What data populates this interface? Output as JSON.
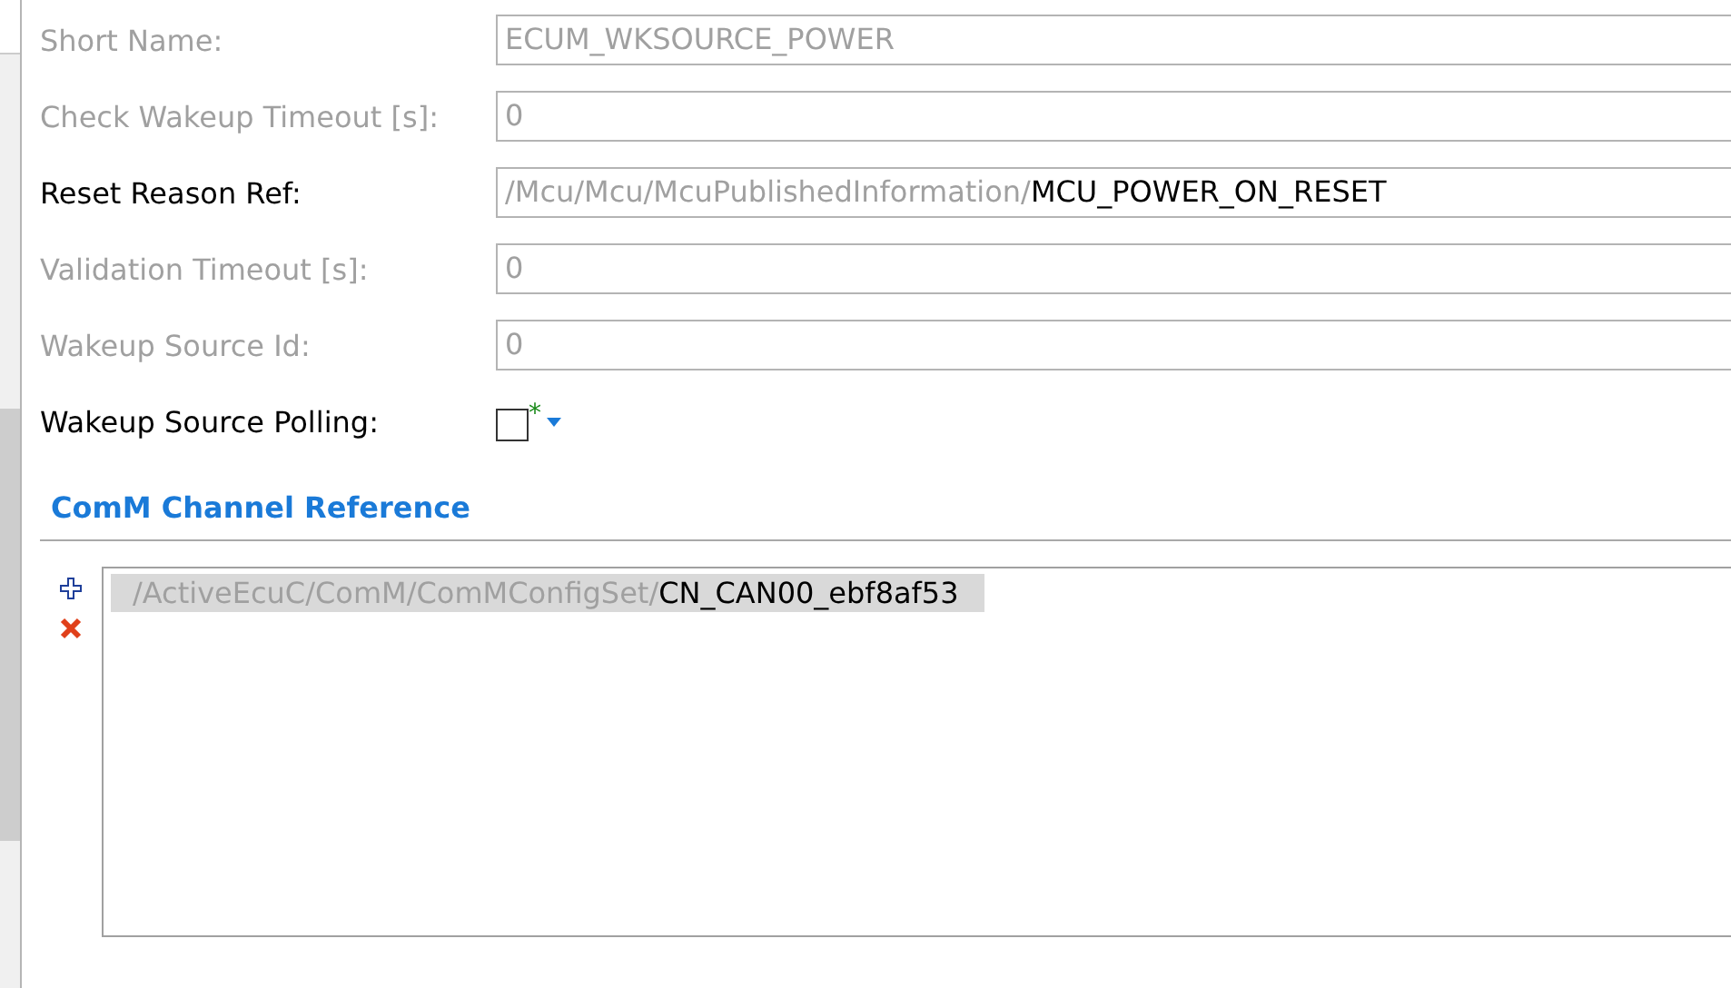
{
  "fields": [
    {
      "kind": "text",
      "label": "Short Name:",
      "disabled": true,
      "value": "ECUM_WKSOURCE_POWER"
    },
    {
      "kind": "text",
      "label": "Check Wakeup Timeout [s]:",
      "disabled": true,
      "value": "0"
    },
    {
      "kind": "reference",
      "label": "Reset Reason Ref:",
      "disabled": false,
      "path": "/Mcu/Mcu/McuPublishedInformation/",
      "value": "MCU_POWER_ON_RESET"
    },
    {
      "kind": "text",
      "label": "Validation Timeout [s]:",
      "disabled": true,
      "value": "0"
    },
    {
      "kind": "text",
      "label": "Wakeup Source Id:",
      "disabled": true,
      "value": "0"
    },
    {
      "kind": "checkbox",
      "label": "Wakeup Source Polling:",
      "disabled": false,
      "checked": false,
      "marker": "*"
    }
  ],
  "section": {
    "title": "ComM Channel Reference",
    "items": [
      {
        "path": "/ActiveEcuC/ComM/ComMConfigSet/",
        "value": "CN_CAN00_ebf8af53",
        "selected": true
      }
    ]
  }
}
